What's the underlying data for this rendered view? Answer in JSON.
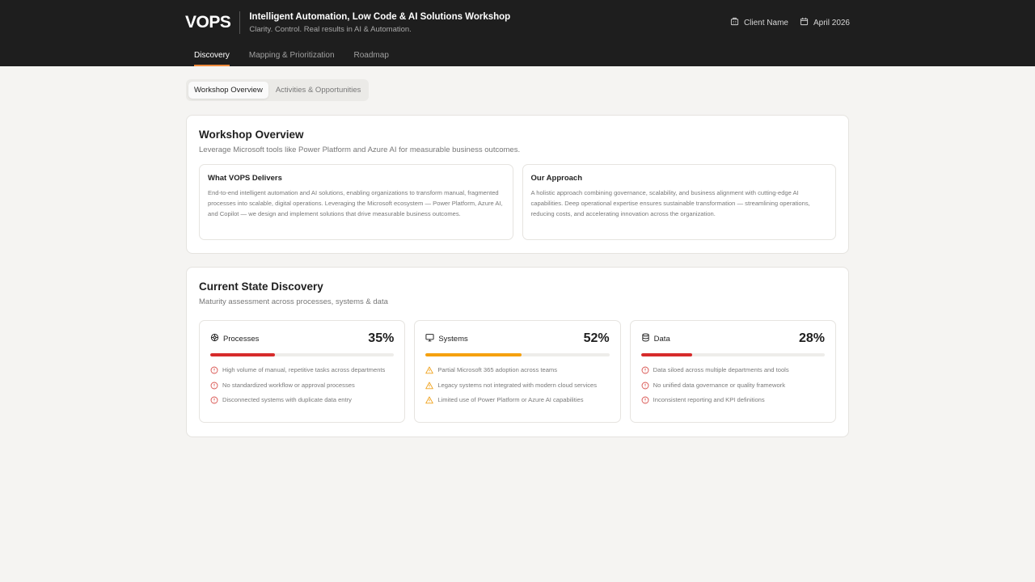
{
  "header": {
    "logo": "VOPS",
    "title": "Intelligent Automation, Low Code & AI Solutions Workshop",
    "subtitle": "Clarity. Control. Real results in AI & Automation.",
    "client_label": "Client Name",
    "date_label": "April 2026",
    "client_icon": "building-icon",
    "date_icon": "calendar-icon"
  },
  "nav": {
    "tabs": [
      {
        "label": "Discovery",
        "active": true
      },
      {
        "label": "Mapping & Prioritization",
        "active": false
      },
      {
        "label": "Roadmap",
        "active": false
      }
    ],
    "accent_color": "#f08a3c"
  },
  "subtabs": [
    {
      "label": "Workshop Overview",
      "active": true
    },
    {
      "label": "Activities & Opportunities",
      "active": false
    }
  ],
  "overview": {
    "title": "Workshop Overview",
    "subtitle": "Leverage Microsoft tools like Power Platform and Azure AI for measurable business outcomes.",
    "cards": [
      {
        "title": "What VOPS Delivers",
        "body": "End-to-end intelligent automation and AI solutions, enabling organizations to transform manual, fragmented processes into scalable, digital operations. Leveraging the Microsoft ecosystem — Power Platform, Azure AI, and Copilot — we design and implement solutions that drive measurable business outcomes."
      },
      {
        "title": "Our Approach",
        "body": "A holistic approach combining governance, scalability, and business alignment with cutting-edge AI capabilities. Deep operational expertise ensures sustainable transformation — streamlining operations, reducing costs, and accelerating innovation across the organization."
      }
    ]
  },
  "discovery": {
    "title": "Current State Discovery",
    "subtitle": "Maturity assessment across processes, systems & data",
    "metrics": [
      {
        "name": "Processes",
        "icon": "settings-icon",
        "percent_label": "35%",
        "percent": 35,
        "bar_color": "#d62b2b",
        "issue_icon": "alert-circle-icon",
        "issue_color": "#d9534f",
        "issues": [
          "High volume of manual, repetitive tasks across departments",
          "No standardized workflow or approval processes",
          "Disconnected systems with duplicate data entry"
        ]
      },
      {
        "name": "Systems",
        "icon": "monitor-icon",
        "percent_label": "52%",
        "percent": 52,
        "bar_color": "#f5a10f",
        "issue_icon": "warning-triangle-icon",
        "issue_color": "#f0a21c",
        "issues": [
          "Partial Microsoft 365 adoption across teams",
          "Legacy systems not integrated with modern cloud services",
          "Limited use of Power Platform or Azure AI capabilities"
        ]
      },
      {
        "name": "Data",
        "icon": "database-icon",
        "percent_label": "28%",
        "percent": 28,
        "bar_color": "#d62b2b",
        "issue_icon": "alert-circle-icon",
        "issue_color": "#d9534f",
        "issues": [
          "Data siloed across multiple departments and tools",
          "No unified data governance or quality framework",
          "Inconsistent reporting and KPI definitions"
        ]
      }
    ]
  }
}
